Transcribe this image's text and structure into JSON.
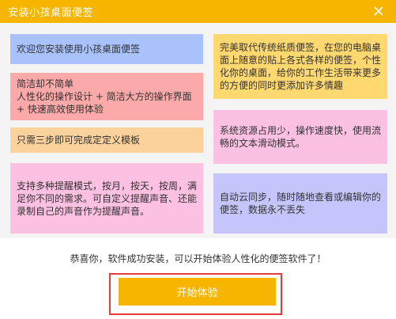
{
  "window": {
    "title": "安装小孩桌面便签"
  },
  "features": {
    "f1": "欢迎您安装使用小孩桌面便签",
    "f2": "简洁却不简单\n人性化的操作设计 + 简洁大方的操作界面 + 快速高效使用体验",
    "f3": "只需三步即可完成定定义模板",
    "f4": "支持多种提醒模式，按月，按天，按周，满足你不同的需求。可自定义提醒声音、还能录制自己的声音作为提醒声音。",
    "f5": "完美取代传统纸质便签，在您的电脑桌面上随意的贴上各式各样的便签，个性化你的桌面，给你的工作生活带来更多的方便的同时更添加许多情趣",
    "f6": "系统资源占用少，操作速度快，使用流畅的文本滑动模式。",
    "f7": "自动云同步，随时随地查看或编辑你的便签，数据永不丢失"
  },
  "footer": {
    "message": "恭喜你，软件成功安装，可以开始体验人性化的便签软件了！",
    "start_label": "开始体验"
  },
  "colors": {
    "accent": "#f7b500",
    "highlight_outline": "#e83c3c"
  },
  "icons": {
    "close": "close-icon"
  }
}
